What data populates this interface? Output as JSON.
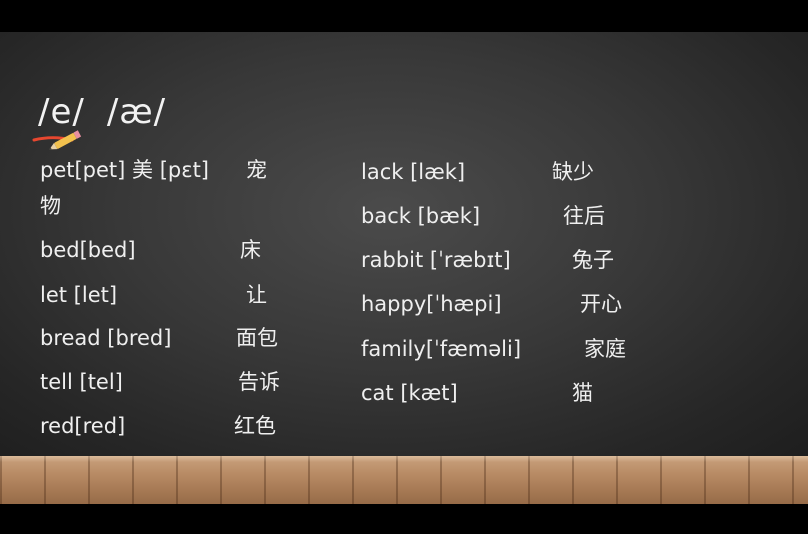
{
  "title": {
    "symbol_1": "/e/",
    "symbol_2": "/æ/"
  },
  "icons": {
    "pencil": "pencil-icon"
  },
  "colors": {
    "board": "#383838",
    "text": "#efefef",
    "floor": "#b98c66",
    "pencil_tip": "#e8472f",
    "pencil_body": "#f2c14e"
  },
  "left_column": [
    {
      "word": "pet[pet]   美 [pɛt]",
      "meaning": "宠"
    },
    {
      "word": "物",
      "meaning": ""
    },
    {
      "word": "bed[bed]",
      "meaning": "床"
    },
    {
      "word": "let [let]",
      "meaning": "让"
    },
    {
      "word": "bread [bred]",
      "meaning": "面包"
    },
    {
      "word": "tell [tel]",
      "meaning": "告诉"
    },
    {
      "word": "red[red]",
      "meaning": "红色"
    }
  ],
  "right_column": [
    {
      "word": "lack [læk]",
      "meaning": "缺少"
    },
    {
      "word": "back [bæk]",
      "meaning": "往后"
    },
    {
      "word": "rabbit [ˈræbɪt]",
      "meaning": "兔子"
    },
    {
      "word": "happy[ˈhæpi]",
      "meaning": "开心"
    },
    {
      "word": "family[ˈfæməli]",
      "meaning": "家庭"
    },
    {
      "word": "cat [kæt]",
      "meaning": "猫"
    }
  ]
}
